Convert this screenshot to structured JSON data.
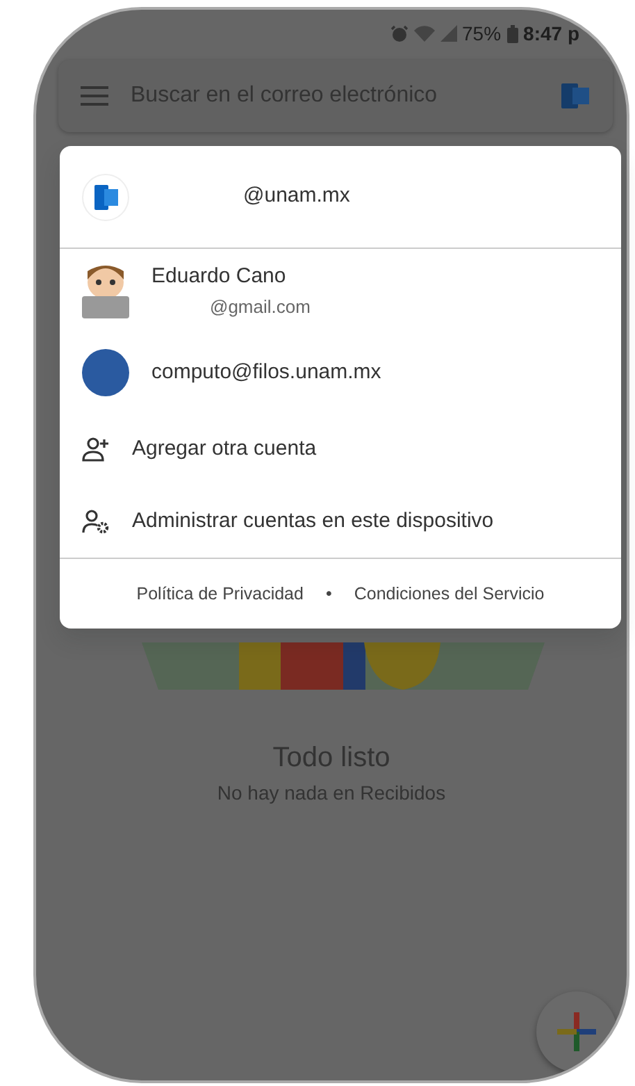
{
  "status_bar": {
    "battery": "75%",
    "time": "8:47 p"
  },
  "search": {
    "placeholder": "Buscar en el correo electrónico"
  },
  "empty_state": {
    "title": "Todo listo",
    "subtitle": "No hay nada en Recibidos"
  },
  "account_menu": {
    "current": {
      "email": "@unam.mx"
    },
    "accounts": [
      {
        "kind": "cartoon",
        "name": "Eduardo Cano",
        "email": "@gmail.com"
      },
      {
        "kind": "photo",
        "email": "computo@filos.unam.mx"
      }
    ],
    "actions": [
      {
        "kind": "add",
        "label": "Agregar otra cuenta"
      },
      {
        "kind": "manage",
        "label": "Administrar cuentas en este dispositivo"
      }
    ],
    "footer": {
      "links": [
        "Política de Privacidad",
        "Condiciones del Servicio"
      ],
      "separator": "•"
    }
  }
}
